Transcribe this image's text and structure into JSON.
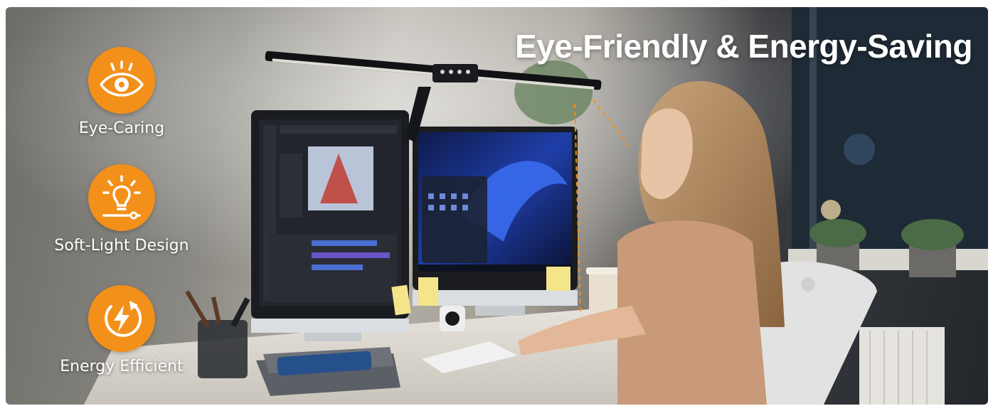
{
  "headline": "Eye-Friendly & Energy-Saving",
  "accent_color": "#F39019",
  "features": [
    {
      "label": "Eye-Caring",
      "icon": "eye-icon"
    },
    {
      "label": "Soft-Light Design",
      "icon": "lightbulb-icon"
    },
    {
      "label": "Energy Efficient",
      "icon": "energy-bolt-icon"
    }
  ]
}
